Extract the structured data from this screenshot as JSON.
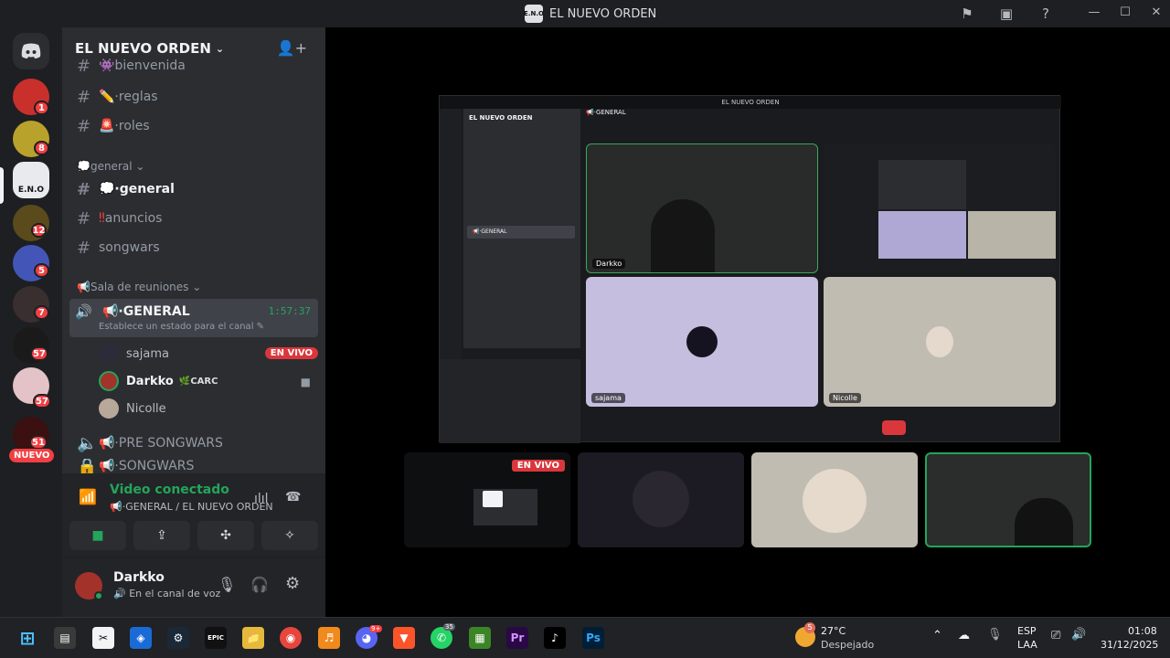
{
  "window": {
    "title": "EL NUEVO ORDEN",
    "logo_text": "E.N.O"
  },
  "server": {
    "name": "EL NUEVO ORDEN",
    "badges": [
      "1",
      "8",
      "12",
      "5",
      "7",
      "57",
      "57",
      "51"
    ],
    "nuevo_label": "NUEVO",
    "eno_label": "E.N.O"
  },
  "channels": {
    "top_partial": "bienvenida",
    "reglas": "reglas",
    "roles": "roles",
    "category_general": "general",
    "general": "general",
    "anuncios": "anuncios",
    "songwars": "songwars",
    "category_sala": "Sala de reuniones",
    "voice_general": "GENERAL",
    "voice_time": "1:57:37",
    "voice_status": "Establece un estado para el canal",
    "pre_songwars": "PRE SONGWARS",
    "songwars_voice": "SONGWARS"
  },
  "voice_users": [
    {
      "name": "sajama",
      "tag": "",
      "live": "EN VIVO"
    },
    {
      "name": "Darkko",
      "tag": "CARC",
      "live": ""
    },
    {
      "name": "Nicolle",
      "tag": "",
      "live": ""
    }
  ],
  "voice_panel": {
    "title": "Video conectado",
    "subtitle": "GENERAL / EL NUEVO ORDEN"
  },
  "user_panel": {
    "name": "Darkko",
    "status": "En el canal de voz"
  },
  "stream": {
    "inner_title": "EL NUEVO ORDEN",
    "inner_header": "EL NUEVO ORDEN",
    "inner_channel": "GENERAL",
    "tiles": [
      "Darkko",
      "sajama",
      "Nicolle"
    ],
    "live_badge": "EN VIVO"
  },
  "taskbar": {
    "weather_temp": "27°C",
    "weather_desc": "Despejado",
    "weather_badge": "5",
    "lang_1": "ESP",
    "lang_2": "LAA",
    "time": "01:08",
    "date": "31/12/2025",
    "discord_badge": "9+",
    "whatsapp_badge": "35"
  },
  "colors": {
    "green": "#23a55a",
    "red": "#f23f43",
    "sidebar": "#2b2d31",
    "rail": "#1e1f22"
  }
}
